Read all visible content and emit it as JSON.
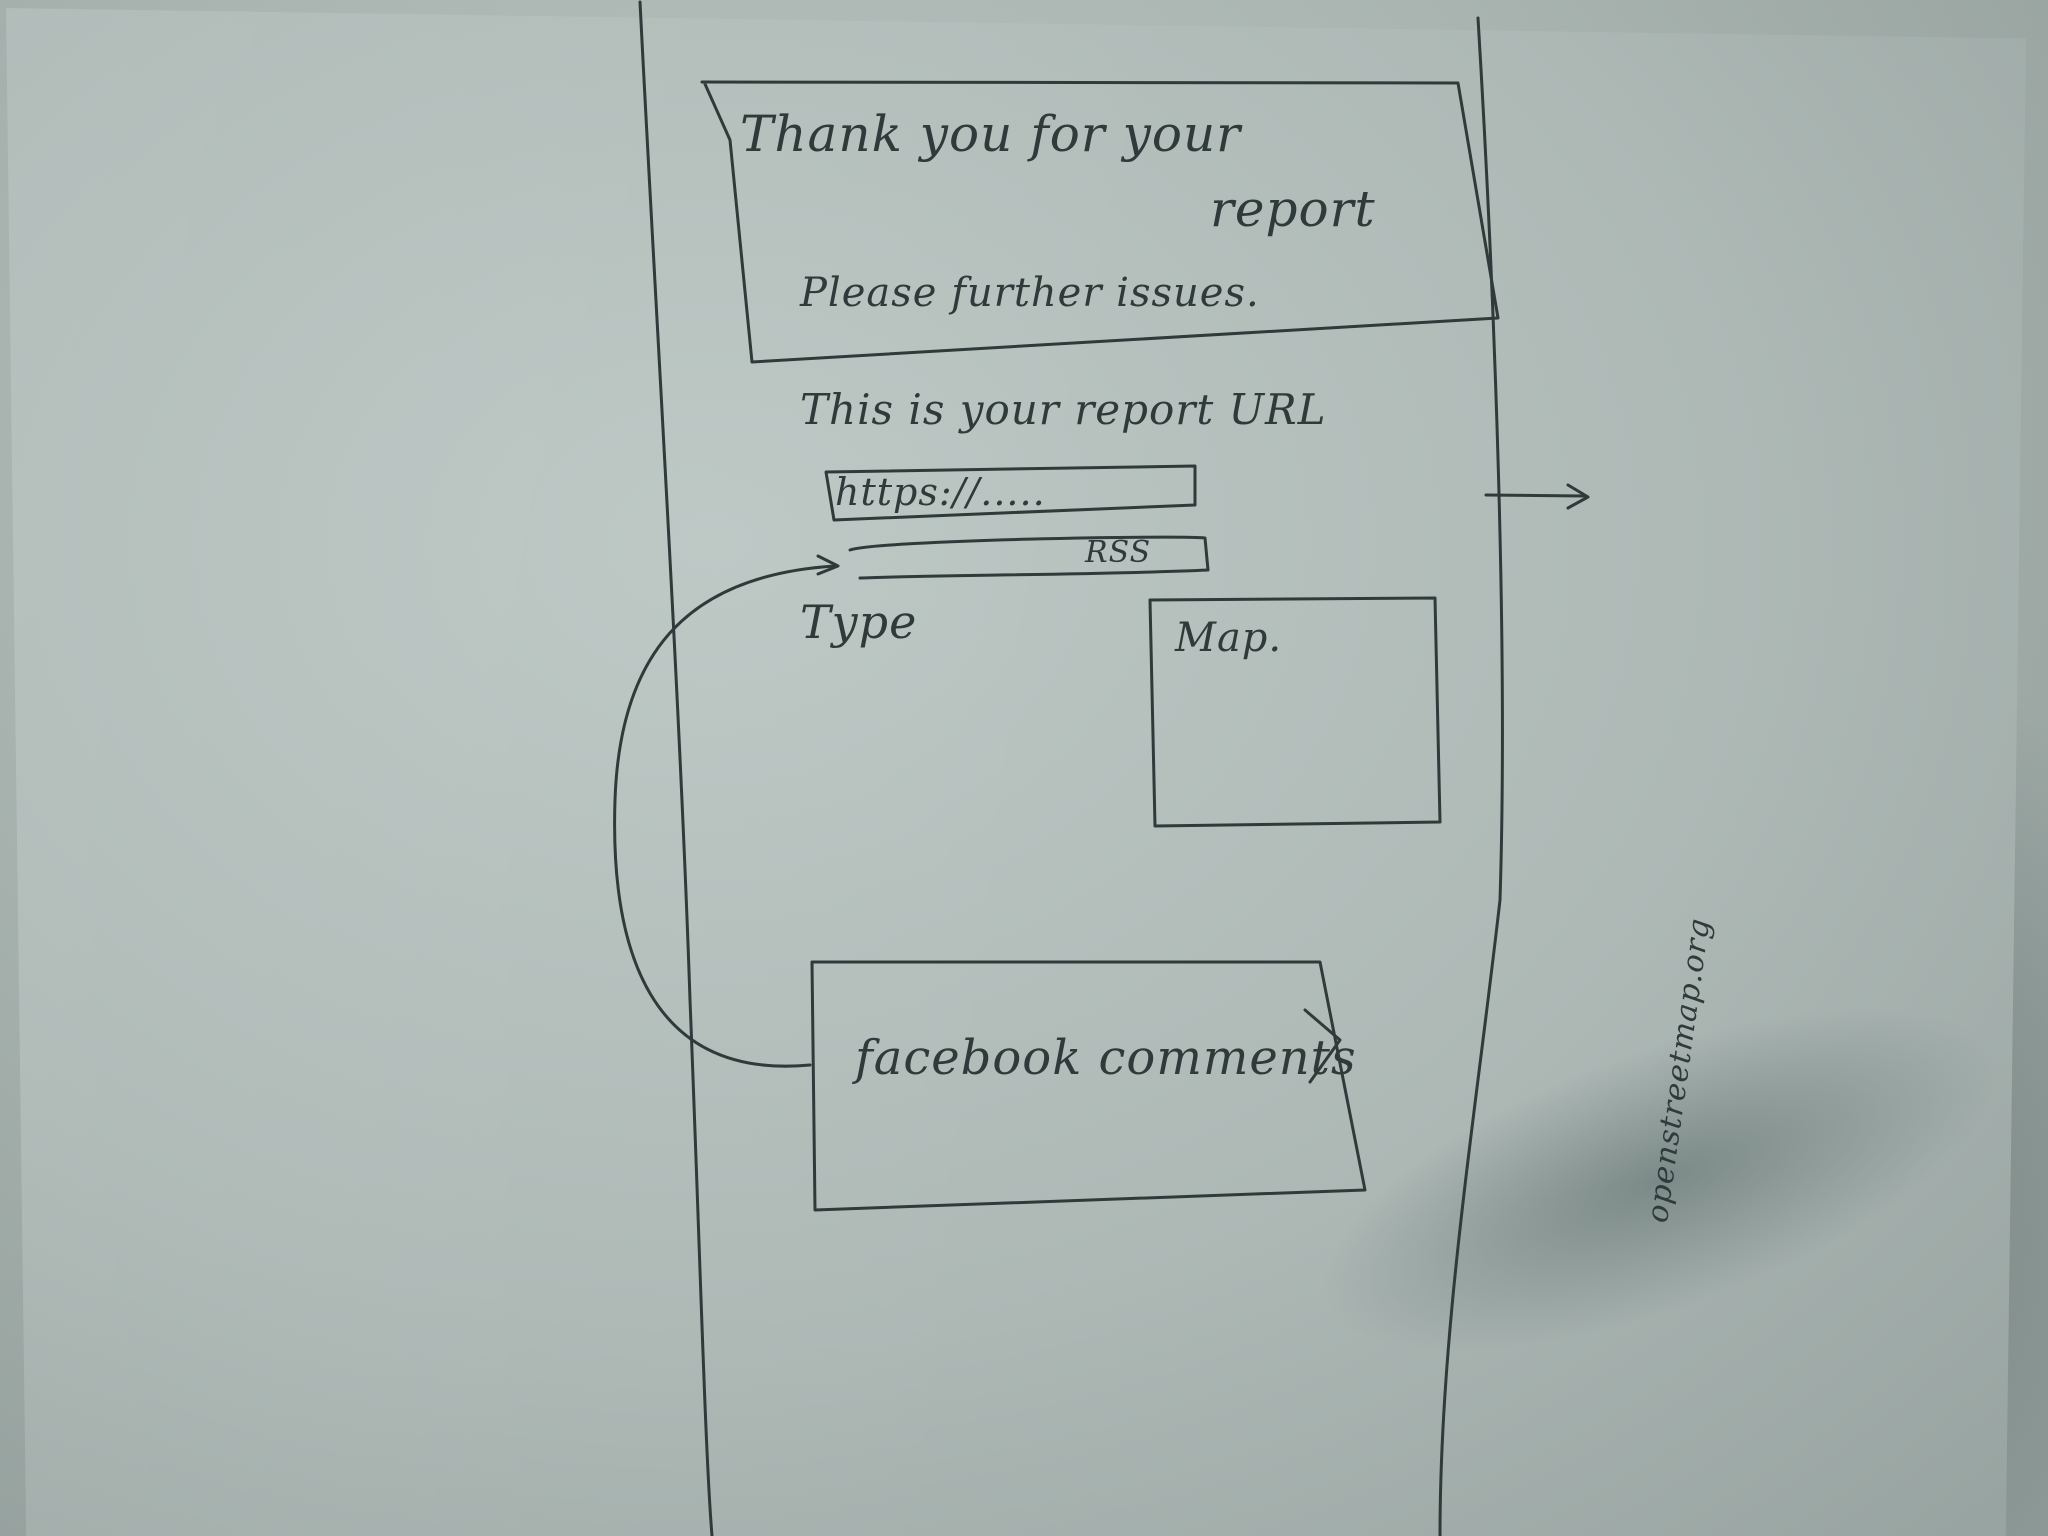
{
  "thank_you": {
    "heading_line1": "Thank you for your",
    "heading_line2": "report",
    "subtext": "Please further issues."
  },
  "report_url": {
    "label": "This is your report URL",
    "value": "https://....."
  },
  "rss": {
    "label": "RSS"
  },
  "type": {
    "label": "Type"
  },
  "map": {
    "label": "Map."
  },
  "facebook": {
    "label": "facebook comments"
  },
  "footer": {
    "side_note": "openstreetmap.org"
  }
}
